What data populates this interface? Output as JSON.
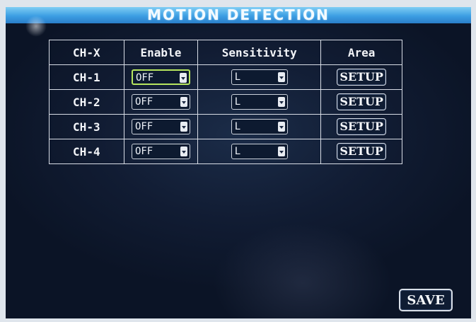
{
  "header": {
    "title": "MOTION DETECTION"
  },
  "table": {
    "columns": [
      "CH-X",
      "Enable",
      "Sensitivity",
      "Area"
    ],
    "rows": [
      {
        "channel": "CH-1",
        "enable": "OFF",
        "sensitivity": "L",
        "area": "SETUP"
      },
      {
        "channel": "CH-2",
        "enable": "OFF",
        "sensitivity": "L",
        "area": "SETUP"
      },
      {
        "channel": "CH-3",
        "enable": "OFF",
        "sensitivity": "L",
        "area": "SETUP"
      },
      {
        "channel": "CH-4",
        "enable": "OFF",
        "sensitivity": "L",
        "area": "SETUP"
      }
    ]
  },
  "footer": {
    "save_label": "SAVE"
  },
  "colors": {
    "title_bar": "#3c9ee3",
    "background": "#111c33",
    "focus": "#b7e65f"
  }
}
